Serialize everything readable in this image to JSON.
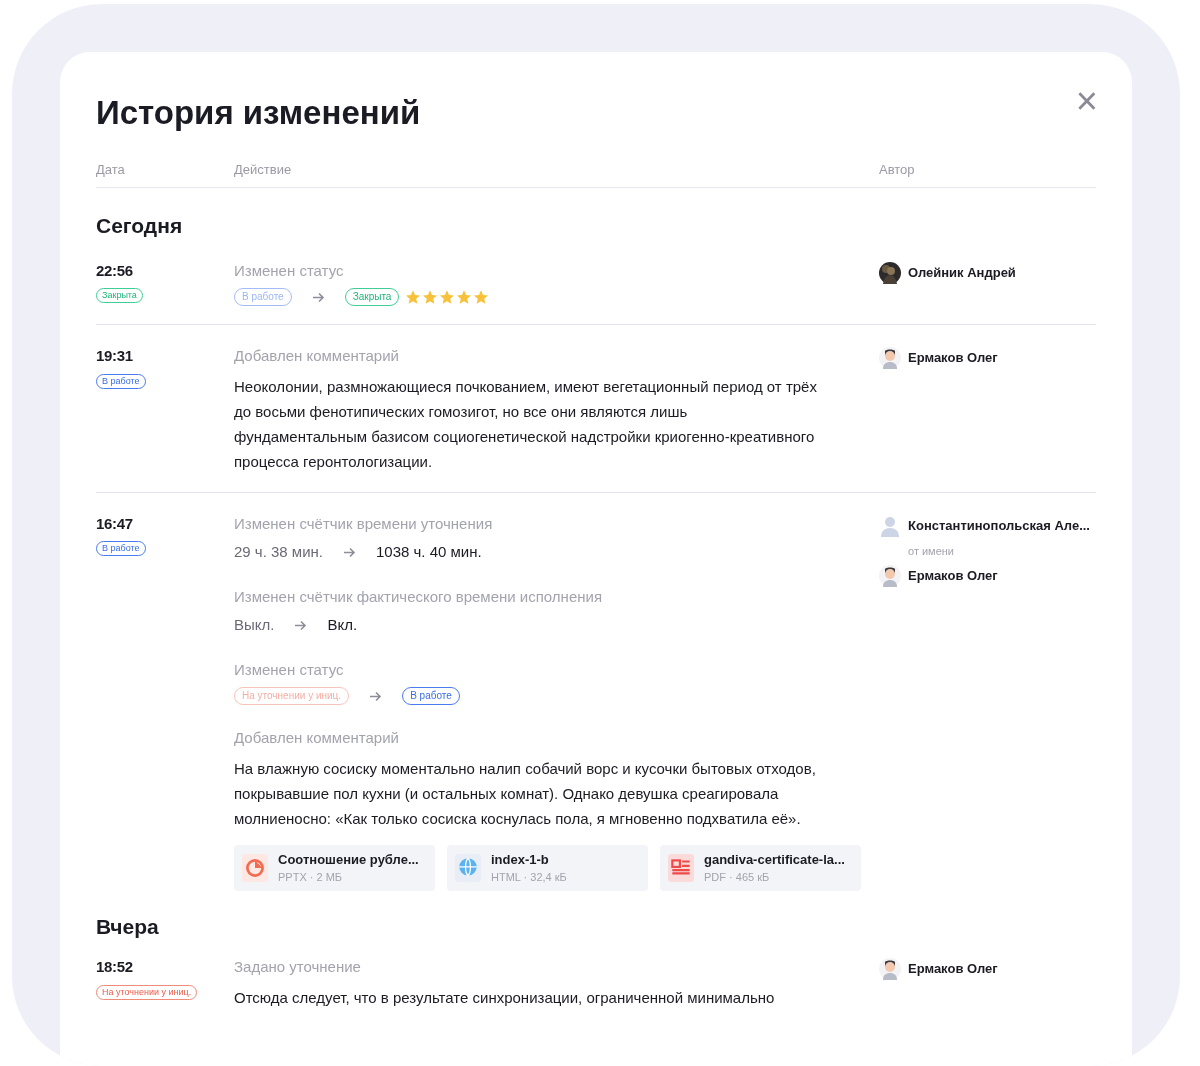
{
  "dialog": {
    "title": "История изменений",
    "close": "×"
  },
  "columns": [
    "Дата",
    "Действие",
    "Автор"
  ],
  "groups": [
    {
      "heading": "Сегодня",
      "entries": [
        {
          "time": "22:56",
          "status": {
            "label": "Закрыта",
            "kind": "closed"
          },
          "authors": [
            {
              "name": "Олейник Андрей"
            }
          ],
          "changes": [
            {
              "kind": "status",
              "title": "Изменен статус",
              "from": {
                "label": "В работе",
                "kind": "work"
              },
              "to": {
                "label": "Закрыта",
                "kind": "closed"
              },
              "stars": 5
            }
          ]
        },
        {
          "time": "19:31",
          "status": {
            "label": "В работе",
            "kind": "work"
          },
          "authors": [
            {
              "name": "Ермаков Олег",
              "kind": "figure"
            }
          ],
          "changes": [
            {
              "kind": "comment",
              "title": "Добавлен комментарий",
              "text": "Неоколонии, размножающиеся почкованием, имеют вегетационный период от трёх до восьми фенотипических гомозигот, но все они являются лишь фундаментальным базисом социогенетической надстройки криогенно-креативного процесса геронтологизации."
            }
          ]
        },
        {
          "time": "16:47",
          "status": {
            "label": "В работе",
            "kind": "work"
          },
          "authors": [
            {
              "name": "Константинопольская Але...",
              "kind": "silhouette"
            },
            {
              "name": "Ермаков Олег",
              "kind": "figure",
              "on_behalf": "от имени"
            }
          ],
          "changes": [
            {
              "kind": "value",
              "title": "Изменен счётчик времени уточнения",
              "from": "29 ч. 38 мин.",
              "to": "1038 ч. 40 мин."
            },
            {
              "kind": "value",
              "title": "Изменен счётчик фактического времени исполнения",
              "from": "Выкл.",
              "to": "Вкл."
            },
            {
              "kind": "status",
              "title": "Изменен статус",
              "from": {
                "label": "На уточнении у иниц.",
                "kind": "clarify"
              },
              "to": {
                "label": "В работе",
                "kind": "work"
              }
            },
            {
              "kind": "comment",
              "title": "Добавлен комментарий",
              "text": "На влажную сосиску моментально налип собачий ворс и кусочки бытовых отходов, покрывавшие пол кухни (и остальных комнат). Однако девушка среагировала молниеносно: «Как только сосиска коснулась пола, я мгновенно подхватила её».",
              "attachments": [
                {
                  "name": "Соотношение рубле...",
                  "meta": "PPTX · 2 МБ",
                  "kind": "pptx"
                },
                {
                  "name": "index-1-b",
                  "meta": "HTML · 32,4 кБ",
                  "kind": "html"
                },
                {
                  "name": "gandiva-certificate-la...",
                  "meta": "PDF · 465 кБ",
                  "kind": "pdf"
                }
              ]
            }
          ]
        }
      ]
    },
    {
      "heading": "Вчера",
      "entries": [
        {
          "time": "18:52",
          "status": {
            "label": "На уточнении у иниц.",
            "kind": "clarify"
          },
          "authors": [
            {
              "name": "Ермаков Олег",
              "kind": "figure"
            }
          ],
          "changes": [
            {
              "kind": "comment",
              "title": "Задано уточнение",
              "text": "Отсюда следует, что в результате синхронизации, ограниченной минимально"
            }
          ]
        }
      ]
    }
  ]
}
